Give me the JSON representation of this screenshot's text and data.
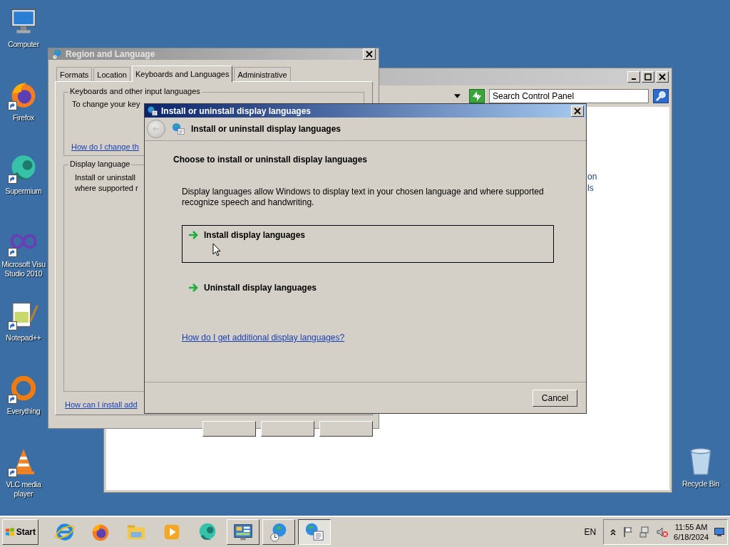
{
  "desktop_icons": [
    {
      "label": "Computer",
      "kind": "monitor",
      "shortcut": false
    },
    {
      "label": "Firefox",
      "kind": "flame-globe",
      "shortcut": true
    },
    {
      "label": "Supermium",
      "kind": "sphere",
      "shortcut": true
    },
    {
      "label": "Microsoft Visu\nStudio 2010",
      "kind": "infinity",
      "shortcut": true
    },
    {
      "label": "Notepad++",
      "kind": "notepad",
      "shortcut": true
    },
    {
      "label": "Everything",
      "kind": "ring",
      "shortcut": true
    },
    {
      "label": "VLC media player",
      "kind": "cone",
      "shortcut": true
    }
  ],
  "recycle_bin": {
    "label": "Recycle Bin"
  },
  "control_panel_window": {
    "search": {
      "placeholder": "Search Control Panel"
    },
    "fragments": [
      "on",
      "ls"
    ]
  },
  "region_window": {
    "title": "Region and Language",
    "active": false,
    "tabs": [
      {
        "label": "Formats",
        "selected": false
      },
      {
        "label": "Location",
        "selected": false
      },
      {
        "label": "Keyboards and Languages",
        "selected": true
      },
      {
        "label": "Administrative",
        "selected": false
      }
    ],
    "keyboards_group": {
      "legend": "Keyboards and other input languages",
      "text": "To change your key",
      "link": "How do I change th"
    },
    "display_group": {
      "legend": "Display language",
      "lines": [
        "Install or uninstall",
        "where supported r"
      ]
    },
    "footer_link": "How can I install add"
  },
  "dialog": {
    "title": "Install or uninstall display languages",
    "header": "Install or uninstall display languages",
    "back_disabled": true,
    "heading": "Choose to install or uninstall display languages",
    "description": "Display languages allow Windows to display text in your chosen language and where supported recognize speech and handwriting.",
    "options": [
      {
        "label": "Install display languages",
        "highlighted": true
      },
      {
        "label": "Uninstall display languages",
        "highlighted": false
      }
    ],
    "link": "How do I get additional display languages?",
    "cancel": "Cancel"
  },
  "taskbar": {
    "start": "Start",
    "apps": [
      {
        "kind": "e-logo",
        "open": false,
        "selected": false
      },
      {
        "kind": "flame-globe",
        "open": false,
        "selected": false
      },
      {
        "kind": "folder",
        "open": false,
        "selected": false
      },
      {
        "kind": "play",
        "open": false,
        "selected": false
      },
      {
        "kind": "sphere",
        "open": false,
        "selected": false
      },
      {
        "kind": "panel",
        "open": true,
        "selected": false
      },
      {
        "kind": "globe-clock",
        "open": true,
        "selected": false
      },
      {
        "kind": "globe-list",
        "open": true,
        "selected": true
      }
    ],
    "language": "EN",
    "time": "11:55 AM",
    "date": "6/18/2024"
  }
}
